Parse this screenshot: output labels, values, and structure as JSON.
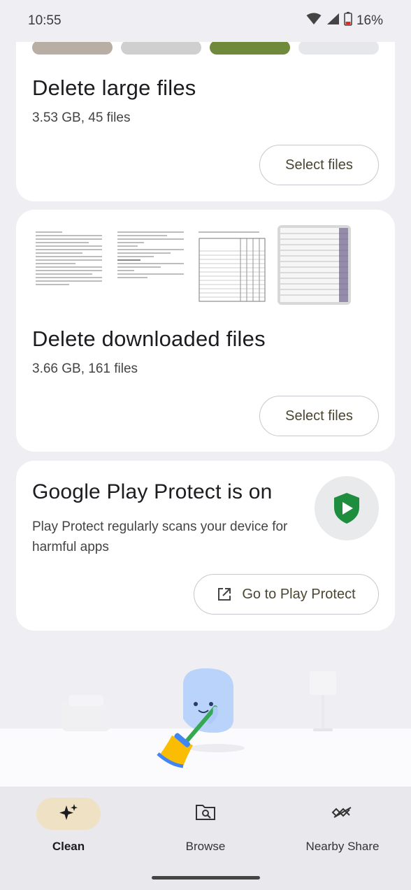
{
  "status_bar": {
    "time": "10:55",
    "battery": "16%"
  },
  "large_files_card": {
    "title": "Delete large files",
    "subtitle": "3.53 GB, 45 files",
    "button_label": "Select files"
  },
  "downloaded_files_card": {
    "title": "Delete downloaded files",
    "subtitle": "3.66 GB, 161 files",
    "button_label": "Select files"
  },
  "play_protect_card": {
    "title": "Google Play Protect is on",
    "description": "Play Protect regularly scans your device for harmful apps",
    "button_label": "Go to Play Protect",
    "icon": "play-protect-shield-icon"
  },
  "bottom_nav": {
    "items": [
      {
        "label": "Clean",
        "icon": "sparkle-icon",
        "active": true
      },
      {
        "label": "Browse",
        "icon": "browse-folder-icon",
        "active": false
      },
      {
        "label": "Nearby Share",
        "icon": "nearby-share-icon",
        "active": false
      }
    ]
  },
  "colors": {
    "background": "#efeef3",
    "card": "#ffffff",
    "active_nav_pill": "#efe2c4",
    "play_protect_green": "#1e8e3e"
  }
}
